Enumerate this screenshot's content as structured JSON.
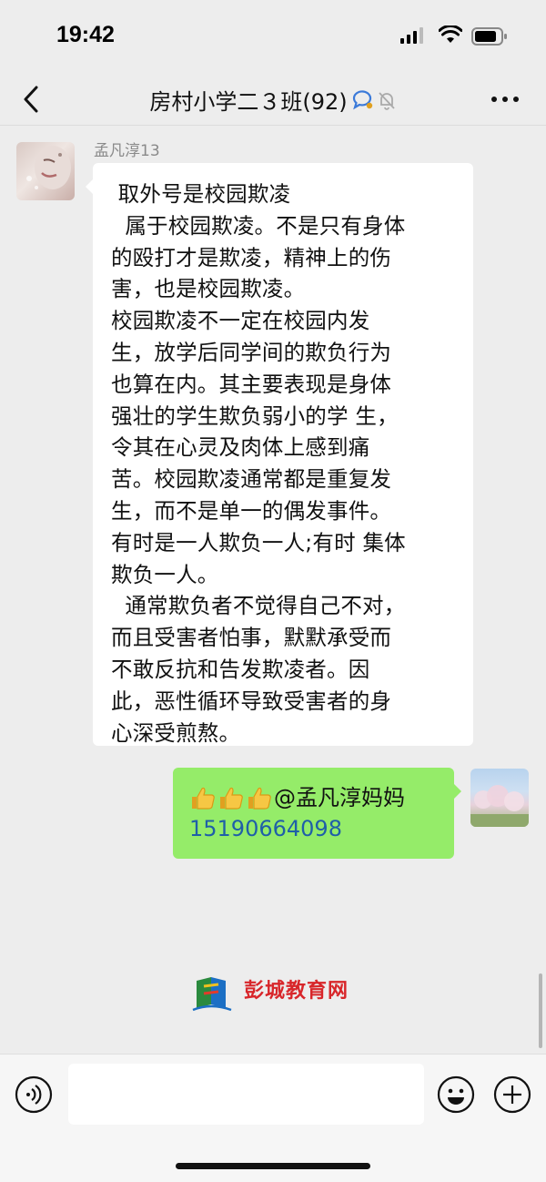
{
  "status_bar": {
    "time": "19:42"
  },
  "header": {
    "title": "房村小学二３班(92)"
  },
  "messages": {
    "incoming": {
      "sender": "孟凡淳13",
      "text": " 取外号是校园欺凌\n  属于校园欺凌。不是只有身体\n的殴打才是欺凌，精神上的伤\n害，也是校园欺凌。\n校园欺凌不一定在校园内发\n生，放学后同学间的欺负行为\n也算在内。其主要表现是身体\n强壮的学生欺负弱小的学 生，\n令其在心灵及肉体上感到痛\n苦。校园欺凌通常都是重复发\n生，而不是单一的偶发事件。\n有时是一人欺负一人;有时 集体\n欺负一人。\n  通常欺负者不觉得自己不对，\n而且受害者怕事，默默承受而\n不敢反抗和告发欺凌者。因\n此，恶性循环导致受害者的身\n心深受煎熬。"
    },
    "outgoing": {
      "mention": "@孟凡淳妈妈",
      "phone": "15190664098"
    }
  },
  "watermark": {
    "text": "彭城教育网"
  },
  "colors": {
    "background": "#ededed",
    "incoming_bubble": "#ffffff",
    "outgoing_bubble": "#95ec69",
    "link": "#1f5fa8",
    "watermark": "#d8262a"
  },
  "icons": [
    "back-arrow-icon",
    "chat-bubble-icon",
    "mute-bell-icon",
    "more-dots-icon",
    "thumbs-up-icon",
    "voice-icon",
    "emoji-icon",
    "plus-icon",
    "signal-icon",
    "wifi-icon",
    "battery-icon"
  ]
}
